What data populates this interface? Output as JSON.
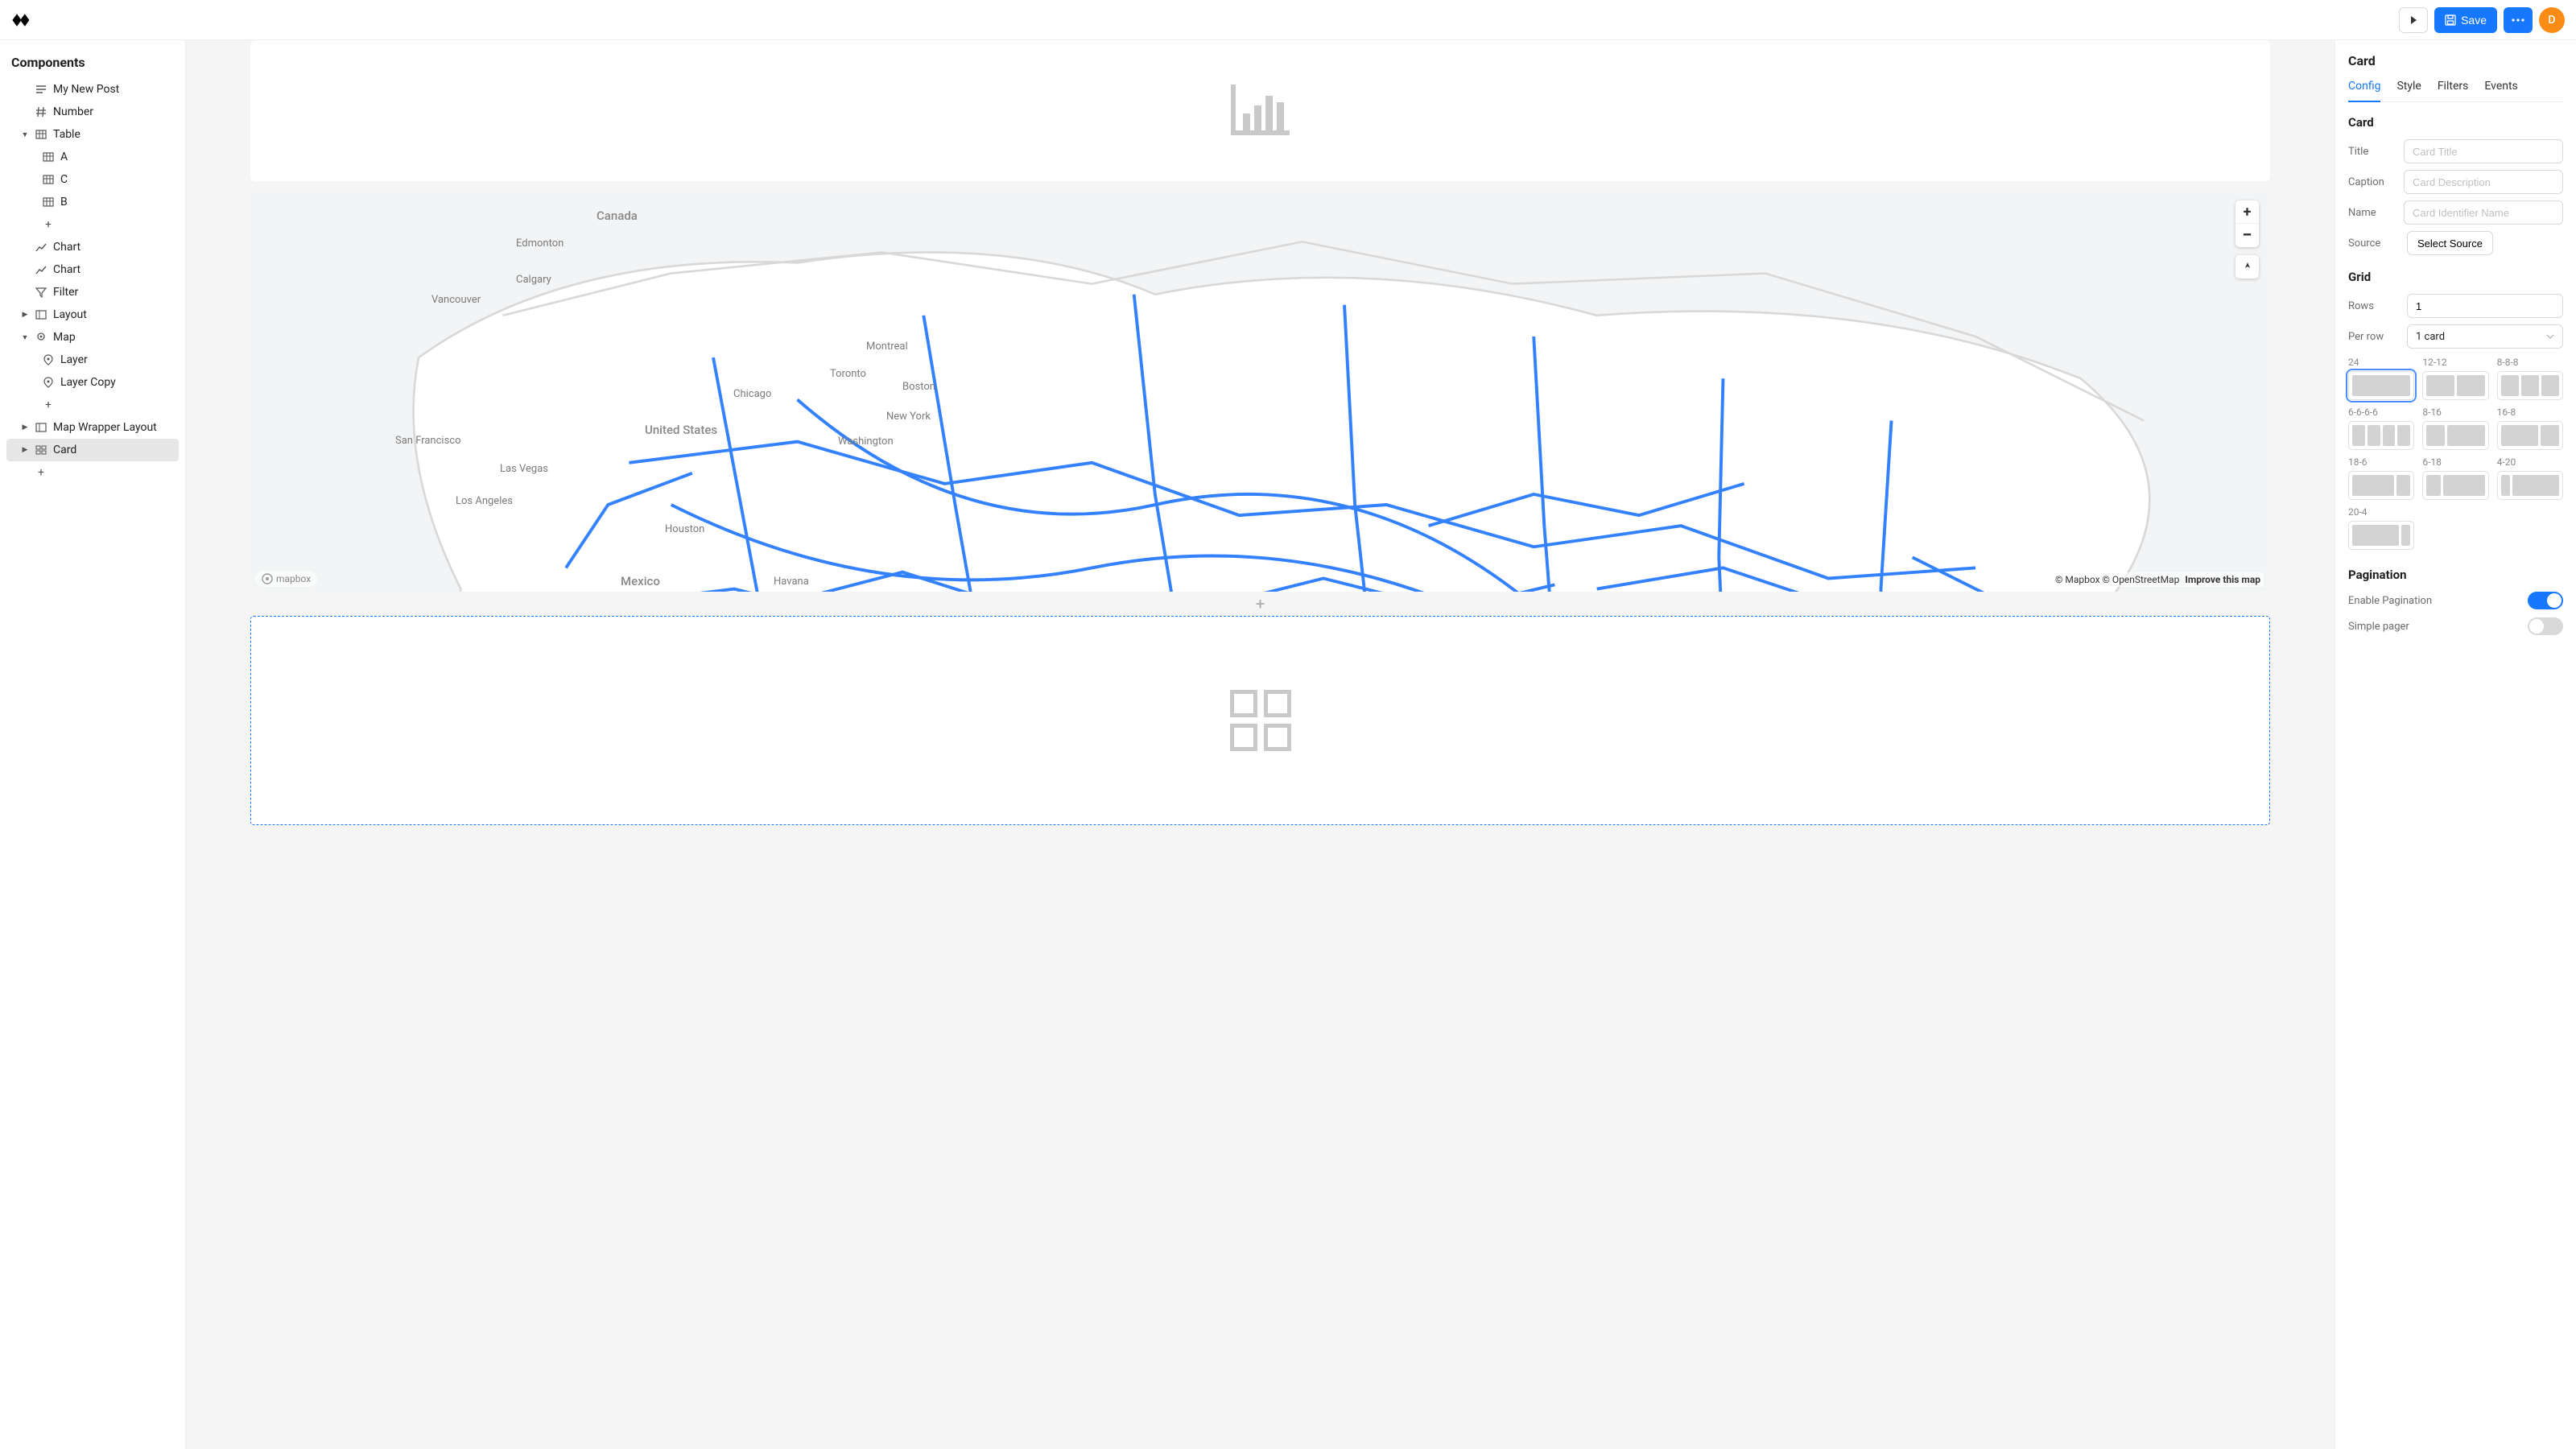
{
  "topbar": {
    "save_label": "Save",
    "avatar_letter": "D"
  },
  "sidebar": {
    "title": "Components",
    "items": [
      {
        "label": "My New Post",
        "icon": "text",
        "indent": 1
      },
      {
        "label": "Number",
        "icon": "hash",
        "indent": 1
      },
      {
        "label": "Table",
        "icon": "table",
        "indent": 1,
        "caret": "down"
      },
      {
        "label": "A",
        "icon": "table",
        "indent": 2
      },
      {
        "label": "C",
        "icon": "table",
        "indent": 2
      },
      {
        "label": "B",
        "icon": "table",
        "indent": 2
      },
      {
        "label": "+",
        "icon": "plus",
        "indent": 2,
        "plus": true
      },
      {
        "label": "Chart",
        "icon": "chart",
        "indent": 1
      },
      {
        "label": "Chart",
        "icon": "chart",
        "indent": 1
      },
      {
        "label": "Filter",
        "icon": "filter",
        "indent": 1
      },
      {
        "label": "Layout",
        "icon": "layout",
        "indent": 1,
        "caret": "right"
      },
      {
        "label": "Map",
        "icon": "map",
        "indent": 1,
        "caret": "down"
      },
      {
        "label": "Layer",
        "icon": "pin",
        "indent": 2
      },
      {
        "label": "Layer Copy",
        "icon": "pin",
        "indent": 2
      },
      {
        "label": "+",
        "icon": "plus",
        "indent": 2,
        "plus": true
      },
      {
        "label": "Map Wrapper Layout",
        "icon": "layout",
        "indent": 1,
        "caret": "right"
      },
      {
        "label": "Card",
        "icon": "card",
        "indent": 1,
        "caret": "right",
        "selected": true
      },
      {
        "label": "+",
        "icon": "plus",
        "indent": 1,
        "plus": true
      }
    ]
  },
  "map": {
    "logo": "mapbox",
    "attribution_mapbox": "© Mapbox",
    "attribution_osm": "© OpenStreetMap",
    "improve_link": "Improve this map",
    "labels": {
      "canada": "Canada",
      "edmonton": "Edmonton",
      "calgary": "Calgary",
      "vancouver": "Vancouver",
      "united_states": "United States",
      "san_francisco": "San Francisco",
      "las_vegas": "Las Vegas",
      "los_angeles": "Los Angeles",
      "chicago": "Chicago",
      "houston": "Houston",
      "mexico": "Mexico",
      "havana": "Havana",
      "montreal": "Montreal",
      "toronto": "Toronto",
      "boston": "Boston",
      "new_york": "New York",
      "washington": "Washington"
    }
  },
  "right": {
    "title": "Card",
    "tabs": [
      "Config",
      "Style",
      "Filters",
      "Events"
    ],
    "active_tab": "Config",
    "card_section": {
      "title": "Card",
      "labels": {
        "title": "Title",
        "caption": "Caption",
        "name": "Name",
        "source": "Source"
      },
      "placeholders": {
        "title": "Card Title",
        "caption": "Card Description",
        "name": "Card Identifier Name"
      },
      "select_source_label": "Select Source"
    },
    "grid_section": {
      "title": "Grid",
      "labels": {
        "rows": "Rows",
        "per_row": "Per row"
      },
      "rows_value": "1",
      "per_row_value": "1 card",
      "layouts": [
        "24",
        "12-12",
        "8-8-8",
        "6-6-6-6",
        "8-16",
        "16-8",
        "18-6",
        "6-18",
        "4-20",
        "20-4"
      ],
      "selected_layout": "24"
    },
    "pagination_section": {
      "title": "Pagination",
      "enable_label": "Enable Pagination",
      "enable_value": true,
      "simple_label": "Simple pager",
      "simple_value": false
    }
  }
}
